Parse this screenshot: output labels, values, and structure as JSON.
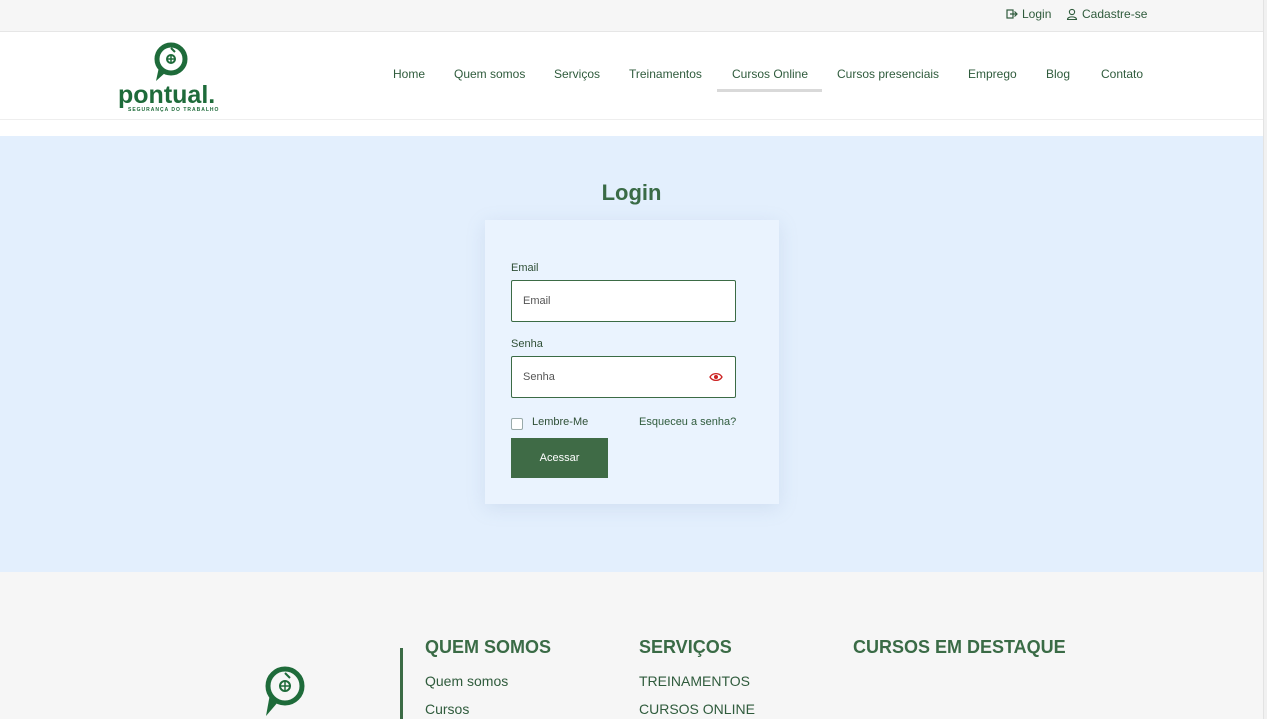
{
  "topbar": {
    "login_label": "Login",
    "signup_label": "Cadastre-se"
  },
  "brand": {
    "name": "pontual.",
    "tagline": "SEGURANÇA DO TRABALHO",
    "color": "#1e6b3a"
  },
  "nav": {
    "items": [
      "Home",
      "Quem somos",
      "Serviços",
      "Treinamentos",
      "Cursos Online",
      "Cursos presenciais",
      "Emprego",
      "Blog",
      "Contato"
    ],
    "active": "Cursos Online"
  },
  "login": {
    "title": "Login",
    "email_label": "Email",
    "email_placeholder": "Email",
    "password_label": "Senha",
    "password_placeholder": "Senha",
    "remember_label": "Lembre-Me",
    "forgot_label": "Esqueceu a senha?",
    "submit_label": "Acessar"
  },
  "footer": {
    "col1": {
      "title": "QUEM SOMOS",
      "links": [
        "Quem somos",
        "Cursos"
      ]
    },
    "col2": {
      "title": "SERVIÇOS",
      "links": [
        "TREINAMENTOS",
        "CURSOS ONLINE"
      ]
    },
    "col3": {
      "title": "CURSOS EM DESTAQUE"
    }
  },
  "colors": {
    "accent": "#3f6b46",
    "hero_bg": "#e3effd",
    "eye_icon": "#cc2222"
  }
}
